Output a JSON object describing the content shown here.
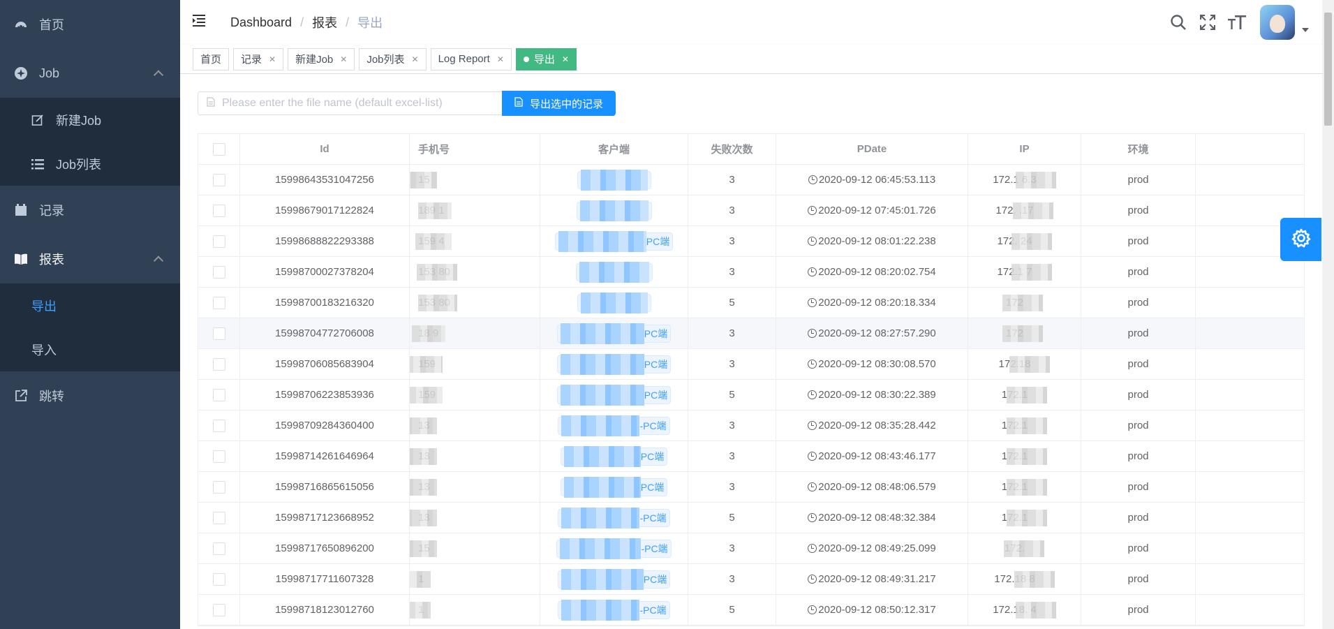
{
  "sidebar": {
    "items": [
      {
        "label": "首页",
        "icon": "dashboard-icon"
      },
      {
        "label": "Job",
        "icon": "job-icon"
      },
      {
        "label": "新建Job",
        "icon": "edit-icon"
      },
      {
        "label": "Job列表",
        "icon": "list-icon"
      },
      {
        "label": "记录",
        "icon": "calendar-icon"
      },
      {
        "label": "报表",
        "icon": "book-icon"
      },
      {
        "label": "导出",
        "active": true
      },
      {
        "label": "导入"
      },
      {
        "label": "跳转",
        "icon": "external-link-icon"
      }
    ]
  },
  "header": {
    "breadcrumb": [
      "Dashboard",
      "报表",
      "导出"
    ]
  },
  "tags": [
    {
      "label": "首页",
      "closable": false
    },
    {
      "label": "记录",
      "closable": true
    },
    {
      "label": "新建Job",
      "closable": true
    },
    {
      "label": "Job列表",
      "closable": true
    },
    {
      "label": "Log Report",
      "closable": true
    },
    {
      "label": "导出",
      "closable": true,
      "active": true
    }
  ],
  "toolbar": {
    "filename_placeholder": "Please enter the file name (default excel-list)",
    "export_label": "导出选中的记录"
  },
  "table": {
    "columns": [
      "Id",
      "手机号",
      "客户端",
      "失败次数",
      "PDate",
      "IP",
      "环境"
    ],
    "rows": [
      {
        "id": "15998643531047256",
        "phone": "15",
        "client": "",
        "fail": "3",
        "pdate": "2020-09-12 06:45:53.113",
        "ip": "172.1  6.3",
        "env": "prod"
      },
      {
        "id": "15998679017122824",
        "phone": "189  1",
        "client": "",
        "fail": "3",
        "pdate": "2020-09-12 07:45:01.726",
        "ip": "172.  .17",
        "env": "prod"
      },
      {
        "id": "15998688822293388",
        "phone": "159  4",
        "client": "PC端",
        "fail": "3",
        "pdate": "2020-09-12 08:01:22.238",
        "ip": "172.  24",
        "env": "prod"
      },
      {
        "id": "15998700027378204",
        "phone": "153  80",
        "client": "",
        "fail": "3",
        "pdate": "2020-09-12 08:20:02.754",
        "ip": "172.1  7",
        "env": "prod"
      },
      {
        "id": "15998700183216320",
        "phone": "153  80",
        "client": "",
        "fail": "5",
        "pdate": "2020-09-12 08:20:18.334",
        "ip": "172",
        "env": "prod"
      },
      {
        "id": "15998704772706008",
        "phone": "18  9",
        "client": "PC端",
        "fail": "3",
        "pdate": "2020-09-12 08:27:57.290",
        "ip": "172",
        "env": "prod"
      },
      {
        "id": "15998706085683904",
        "phone": "159",
        "client": "PC端",
        "fail": "3",
        "pdate": "2020-09-12 08:30:08.570",
        "ip": "172.18",
        "env": "prod"
      },
      {
        "id": "15998706223853936",
        "phone": "159",
        "client": "PC端",
        "fail": "5",
        "pdate": "2020-09-12 08:30:22.389",
        "ip": "172.1",
        "env": "prod"
      },
      {
        "id": "15998709284360400",
        "phone": "13",
        "client": "-PC端",
        "fail": "3",
        "pdate": "2020-09-12 08:35:28.442",
        "ip": "172.1",
        "env": "prod"
      },
      {
        "id": "15998714261646964",
        "phone": "13",
        "client": "PC端",
        "fail": "3",
        "pdate": "2020-09-12 08:43:46.177",
        "ip": "172.1",
        "env": "prod"
      },
      {
        "id": "15998716865615056",
        "phone": "13",
        "client": "PC端",
        "fail": "3",
        "pdate": "2020-09-12 08:48:06.579",
        "ip": "172.1",
        "env": "prod"
      },
      {
        "id": "15998717123668952",
        "phone": "13",
        "client": "-PC端",
        "fail": "5",
        "pdate": "2020-09-12 08:48:32.384",
        "ip": "172.1",
        "env": "prod"
      },
      {
        "id": "15998717650896200",
        "phone": "15",
        "client": "-PC端",
        "fail": "3",
        "pdate": "2020-09-12 08:49:25.099",
        "ip": "172.",
        "env": "prod"
      },
      {
        "id": "15998717711607328",
        "phone": "1",
        "client": "PC端",
        "fail": "3",
        "pdate": "2020-09-12 08:49:31.217",
        "ip": "172.18  8",
        "env": "prod"
      },
      {
        "id": "15998718123012760",
        "phone": "1",
        "client": "-PC端",
        "fail": "5",
        "pdate": "2020-09-12 08:50:12.317",
        "ip": "172.18.  4",
        "env": "prod"
      }
    ]
  },
  "colors": {
    "sidebar_bg": "#304156",
    "sidebar_sub_bg": "#1f2d3d",
    "accent": "#409eff",
    "tag_active": "#42b983",
    "button_primary": "#1890ff"
  }
}
